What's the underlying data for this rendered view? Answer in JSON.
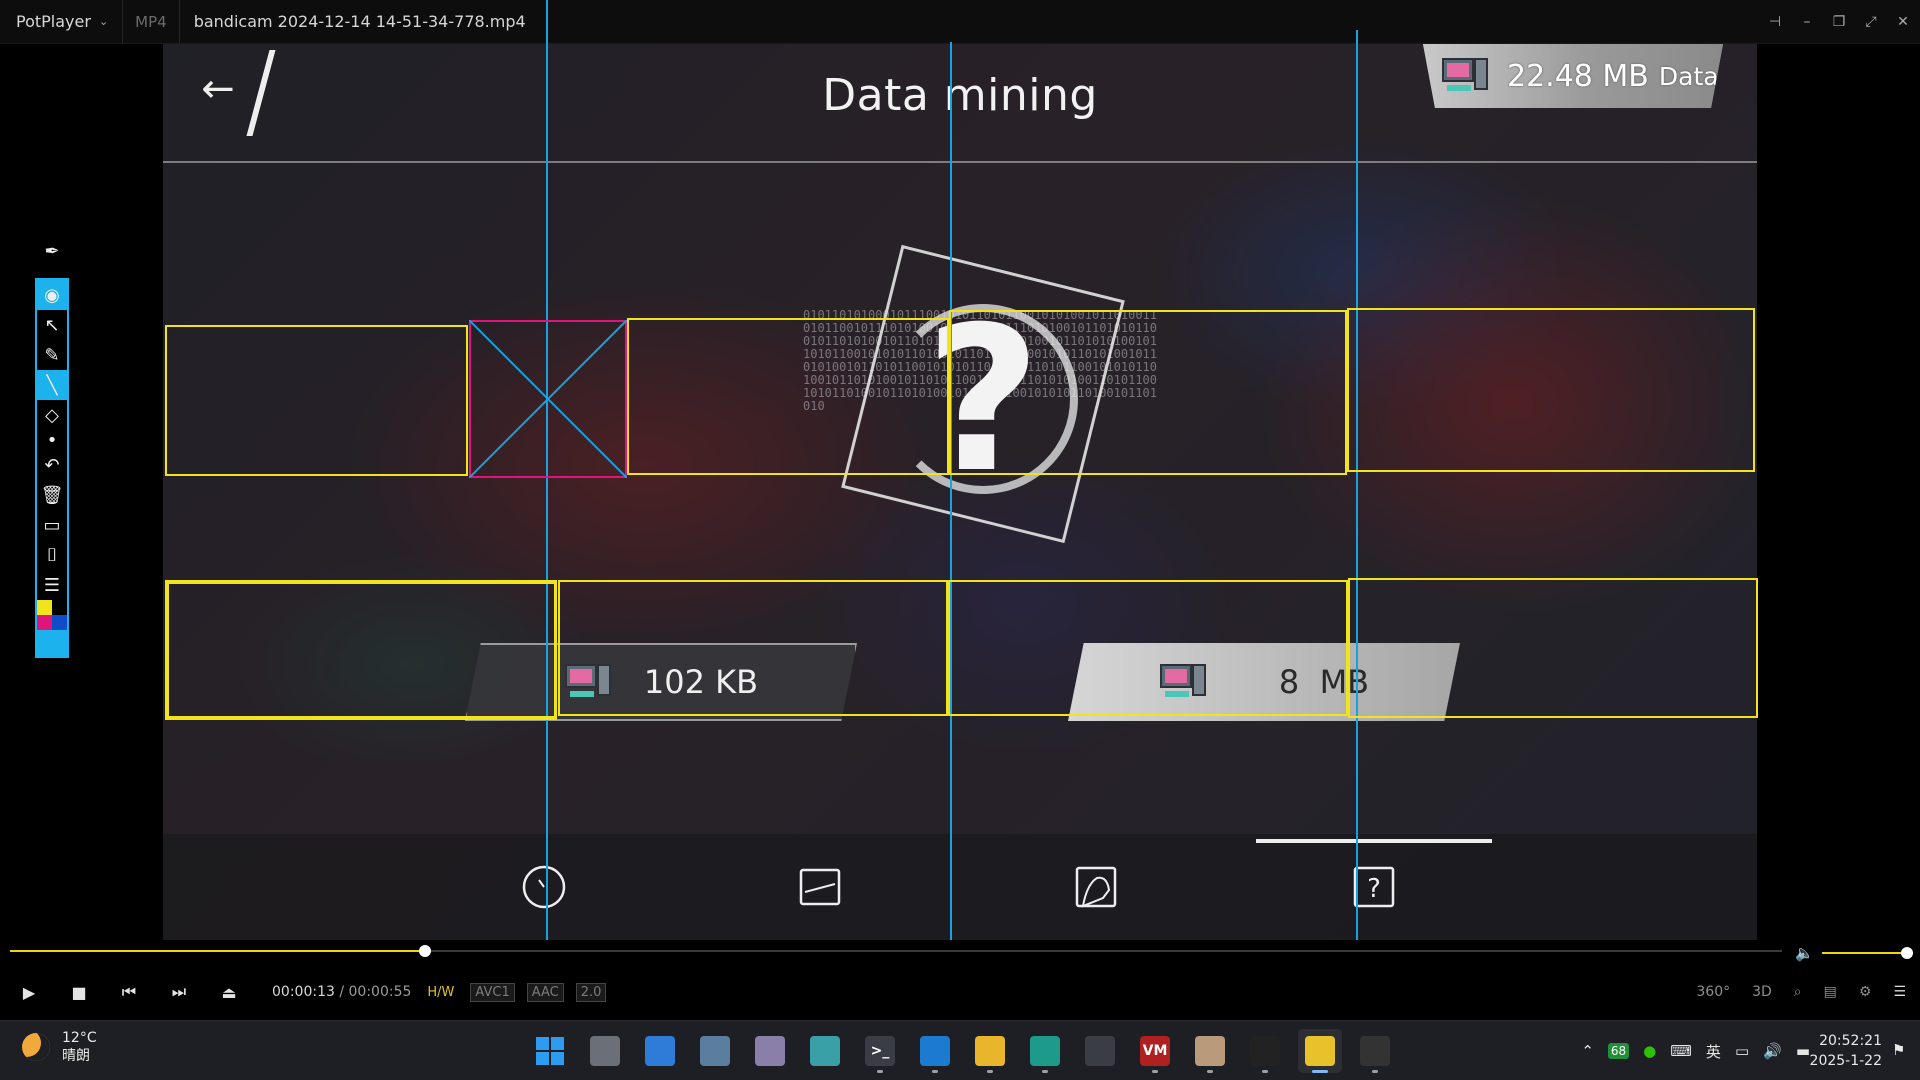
{
  "titlebar": {
    "app_name": "PotPlayer",
    "format": "MP4",
    "filename": "bandicam 2024-12-14 14-51-34-778.mp4"
  },
  "video": {
    "page_title": "Data mining",
    "data_badge": {
      "amount": "22.48 MB",
      "label": "Data"
    },
    "chip_left": {
      "value": "102",
      "unit": "KB"
    },
    "chip_right": {
      "value": "8",
      "unit": "MB"
    },
    "emblem_binary": "0101101010001011100101011010110010101001011010011010110010111010100101101010011101010010110101011001011010100101101011001010101101001011010101001011010110010101011010010110101011001010110101001011010100101101011001010101101001011010110010101011010010110101001011010110010101011010101001101011001010110100101101010010110101100101010110100101101010"
  },
  "player": {
    "time_current": "00:00:13",
    "time_separator": " / ",
    "time_total": "00:00:55",
    "progress_fraction": 0.234,
    "tags": [
      "H/W",
      "AVC1",
      "AAC",
      "2.0"
    ],
    "right_buttons": [
      "360°",
      "3D",
      "search-icon",
      "subtitle-icon",
      "gear-icon",
      "menu-icon"
    ]
  },
  "taskbar": {
    "weather_temp": "12°C",
    "weather_desc": "晴朗",
    "apps": [
      {
        "name": "start",
        "color": "#2d9bf0",
        "glyph": ""
      },
      {
        "name": "task-view",
        "color": "#6b7078",
        "glyph": ""
      },
      {
        "name": "photos",
        "color": "#2f7bd8",
        "glyph": ""
      },
      {
        "name": "steam-like",
        "color": "#5c7e9e",
        "glyph": ""
      },
      {
        "name": "anime-app",
        "color": "#8a7fa8",
        "glyph": ""
      },
      {
        "name": "triangle-app",
        "color": "#38a0a6",
        "glyph": ""
      },
      {
        "name": "terminal",
        "color": "#3a3d44",
        "glyph": ">_"
      },
      {
        "name": "vscode",
        "color": "#1c7bd1",
        "glyph": ""
      },
      {
        "name": "file-explorer",
        "color": "#e9b52a",
        "glyph": ""
      },
      {
        "name": "edge",
        "color": "#1d9a8a",
        "glyph": ""
      },
      {
        "name": "scp",
        "color": "#3a3d44",
        "glyph": ""
      },
      {
        "name": "voicemeeter",
        "color": "#b02020",
        "glyph": "VM"
      },
      {
        "name": "character-app",
        "color": "#b99a7a",
        "glyph": ""
      },
      {
        "name": "qq",
        "color": "#222",
        "glyph": ""
      },
      {
        "name": "potplayer",
        "color": "#e8c22a",
        "glyph": ""
      },
      {
        "name": "pen-tool",
        "color": "#333",
        "glyph": ""
      }
    ],
    "tray_badge": "68",
    "ime": "英",
    "time": "20:52:21",
    "date": "2025-1-22"
  },
  "colors": {
    "annotation_blue": "#18a2e0",
    "annotation_yellow": "#f1e41b",
    "annotation_pink": "#e0157c",
    "seek_accent": "#f1d40f"
  }
}
